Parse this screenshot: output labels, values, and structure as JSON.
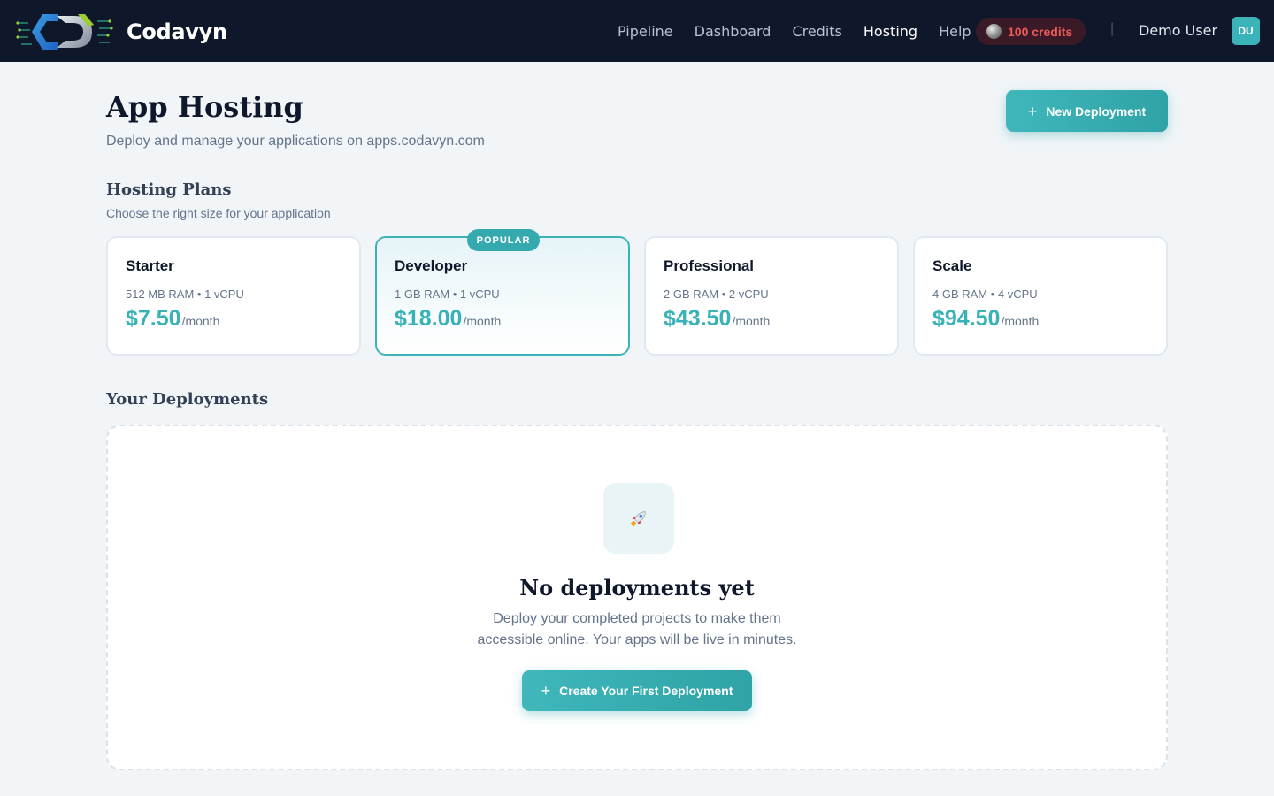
{
  "header": {
    "brand_name": "Codavyn",
    "logo_icon": "codavyn-logo-icon",
    "nav": [
      {
        "label": "Pipeline",
        "active": false
      },
      {
        "label": "Dashboard",
        "active": false
      },
      {
        "label": "Credits",
        "active": false
      },
      {
        "label": "Hosting",
        "active": true
      },
      {
        "label": "Help",
        "active": false
      }
    ],
    "credits_label": "100 credits",
    "separator": "|",
    "user_name": "Demo User",
    "avatar_initials": "DU"
  },
  "page": {
    "title": "App Hosting",
    "subtitle": "Deploy and manage your applications on apps.codavyn.com",
    "new_deployment_label": "New Deployment",
    "plus_glyph": "+"
  },
  "plans": {
    "title": "Hosting Plans",
    "subtitle": "Choose the right size for your application",
    "items": [
      {
        "name": "Starter",
        "spec": "512 MB RAM • 1 vCPU",
        "price": "$7.50",
        "unit": "/month",
        "popular": false
      },
      {
        "name": "Developer",
        "spec": "1 GB RAM • 1 vCPU",
        "price": "$18.00",
        "unit": "/month",
        "popular": true,
        "badge": "POPULAR"
      },
      {
        "name": "Professional",
        "spec": "2 GB RAM • 2 vCPU",
        "price": "$43.50",
        "unit": "/month",
        "popular": false
      },
      {
        "name": "Scale",
        "spec": "4 GB RAM • 4 vCPU",
        "price": "$94.50",
        "unit": "/month",
        "popular": false
      }
    ]
  },
  "deployments": {
    "title": "Your Deployments",
    "empty_icon": "rocket-icon",
    "empty_glyph": "🚀",
    "empty_title": "No deployments yet",
    "empty_desc": "Deploy your completed projects to make them accessible online. Your apps will be live in minutes.",
    "cta_label": "Create Your First Deployment"
  },
  "colors": {
    "accent": "#38b2b7",
    "header_bg": "#0f172a",
    "credits_text": "#f05a5a",
    "page_bg": "#f1f5f8"
  }
}
